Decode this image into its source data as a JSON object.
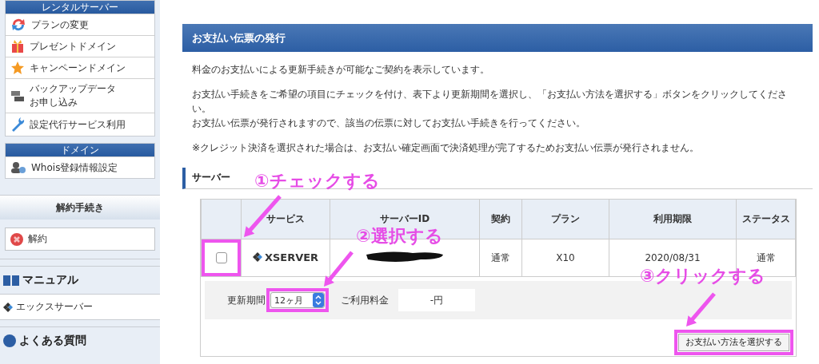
{
  "sidebar": {
    "panels": [
      {
        "kind": "menu",
        "title": "レンタルサーバー",
        "items": [
          {
            "lines": [
              "プランの変更"
            ]
          },
          {
            "lines": [
              "プレゼントドメイン"
            ]
          },
          {
            "lines": [
              "キャンペーンドメイン"
            ]
          },
          {
            "lines": [
              "バックアップデータ",
              "お申し込み"
            ]
          },
          {
            "lines": [
              "設定代行サービス利用"
            ]
          }
        ]
      },
      {
        "kind": "menu",
        "title": "ドメイン",
        "items": [
          {
            "lines": [
              "Whois登録情報設定"
            ]
          }
        ]
      },
      {
        "kind": "boxed",
        "title": "解約手続き",
        "items": [
          "解約"
        ]
      },
      {
        "kind": "heading",
        "title": "マニュアル",
        "items": [
          "エックスサーバー"
        ]
      },
      {
        "kind": "heading",
        "title": "よくある質問"
      }
    ]
  },
  "main": {
    "title": "お支払い伝票の発行",
    "paragraphs": [
      [
        "料金のお支払いによる更新手続きが可能なご契約を表示しています。"
      ],
      [
        "お支払い手続きをご希望の項目にチェックを付け、表下より更新期間を選択し、「お支払い方法を選択する」ボタンをクリックしてください。",
        "お支払い伝票が発行されますので、該当の伝票に対してお支払い手続きを行ってください。"
      ],
      [
        "※クレジット決済を選択された場合は、お支払い確定画面で決済処理が完了するためお支払い伝票が発行されません。"
      ]
    ],
    "section": "サーバー",
    "table": {
      "columns": [
        "サービス",
        "サーバーID",
        "契約",
        "プラン",
        "利用期限",
        "ステータス"
      ],
      "rows": [
        {
          "checked": false,
          "service": "XSERVER",
          "contract": "通常",
          "plan": "X10",
          "expiry": "2020/08/31",
          "status": "通常"
        }
      ]
    },
    "renewal": {
      "period_label": "更新期間",
      "period_value": "12ヶ月",
      "fee_label": "ご利用料金",
      "fee_value": "-円"
    },
    "button": "お支払い方法を選択する"
  },
  "annotations": [
    "①チェックする",
    "②選択する",
    "③クリックする"
  ]
}
